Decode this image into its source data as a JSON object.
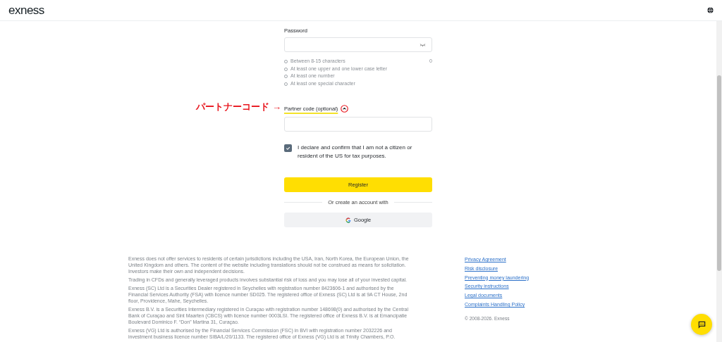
{
  "header": {
    "logo": "exness"
  },
  "password": {
    "label": "Password",
    "counter": "0",
    "rules": [
      {
        "text": "Between 8-15 characters",
        "met": false
      },
      {
        "text": "At least one upper and one lower case letter",
        "met": false
      },
      {
        "text": "At least one number",
        "met": false
      },
      {
        "text": "At least one special character",
        "met": false
      }
    ]
  },
  "partner_code": {
    "label": "Partner code (optional)",
    "expanded": true,
    "annotation": "パートナーコード →"
  },
  "declaration": {
    "text": "I declare and confirm that I am not a citizen or resident of the US for tax purposes.",
    "checked": true
  },
  "register_button": "Register",
  "divider_text": "Or create an account with",
  "google_button": "Google",
  "footer": {
    "paragraphs": [
      "Exness does not offer services to residents of certain jurisdictions including the USA, Iran, North Korea, the European Union, the United Kingdom and others. The content of the website including translations should not be construed as means for solicitation. Investors make their own and independent decisions.",
      "Trading in CFDs and generally leveraged products involves substantial risk of loss and you may lose all of your invested capital.",
      "Exness (SC) Ltd is a Securities Dealer registered in Seychelles with registration number 8423606-1 and authorised by the Financial Services Authority (FSA) with licence number SD025. The registered office of Exness (SC) Ltd is at 9A CT House, 2nd floor, Providence, Mahe, Seychelles.",
      "Exness B.V. is a Securities Intermediary registered in Curaçao with registration number 148698(0) and authorised by the Central Bank of Curaçao and Sint Maarten (CBCS) with licence number 0003LSI. The registered office of Exness B.V. is at Emancipatie Boulevard Dominico F. “Don” Martina 31, Curaçao.",
      "Exness (VG) Ltd is authorised by the Financial Services Commission (FSC) in BVI with registration number 2032226 and investment business licence number SIBA/L/20/1133. The registered office of Exness (VG) Ltd is at Trinity Chambers, P.O."
    ],
    "links": [
      "Privacy Agreement",
      "Risk disclosure",
      "Preventing money laundering",
      "Security instructions",
      "Legal documents",
      "Complaints Handling Policy"
    ],
    "copyright": "© 2008-2026. Exness"
  }
}
